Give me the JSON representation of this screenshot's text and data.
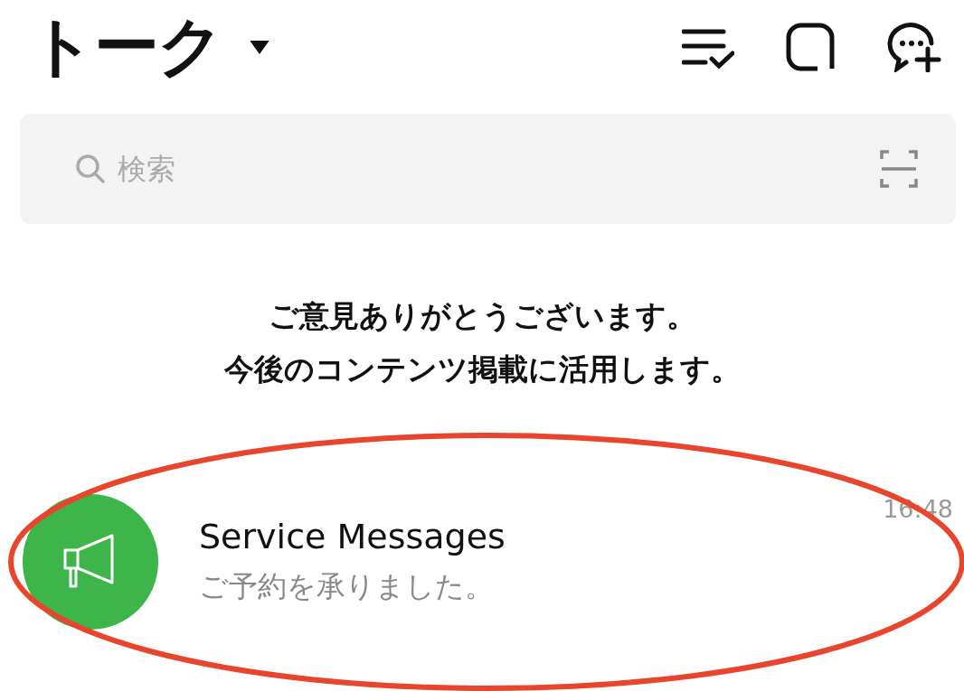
{
  "header": {
    "title": "トーク"
  },
  "search": {
    "placeholder": "検索"
  },
  "notice": {
    "lines": [
      "ご意見ありがとうございます。",
      "今後のコンテンツ掲載に活用します。"
    ]
  },
  "chats": [
    {
      "name": "Service Messages",
      "preview": "ご予約を承りました。",
      "time": "16:48",
      "highlighted": true
    }
  ]
}
